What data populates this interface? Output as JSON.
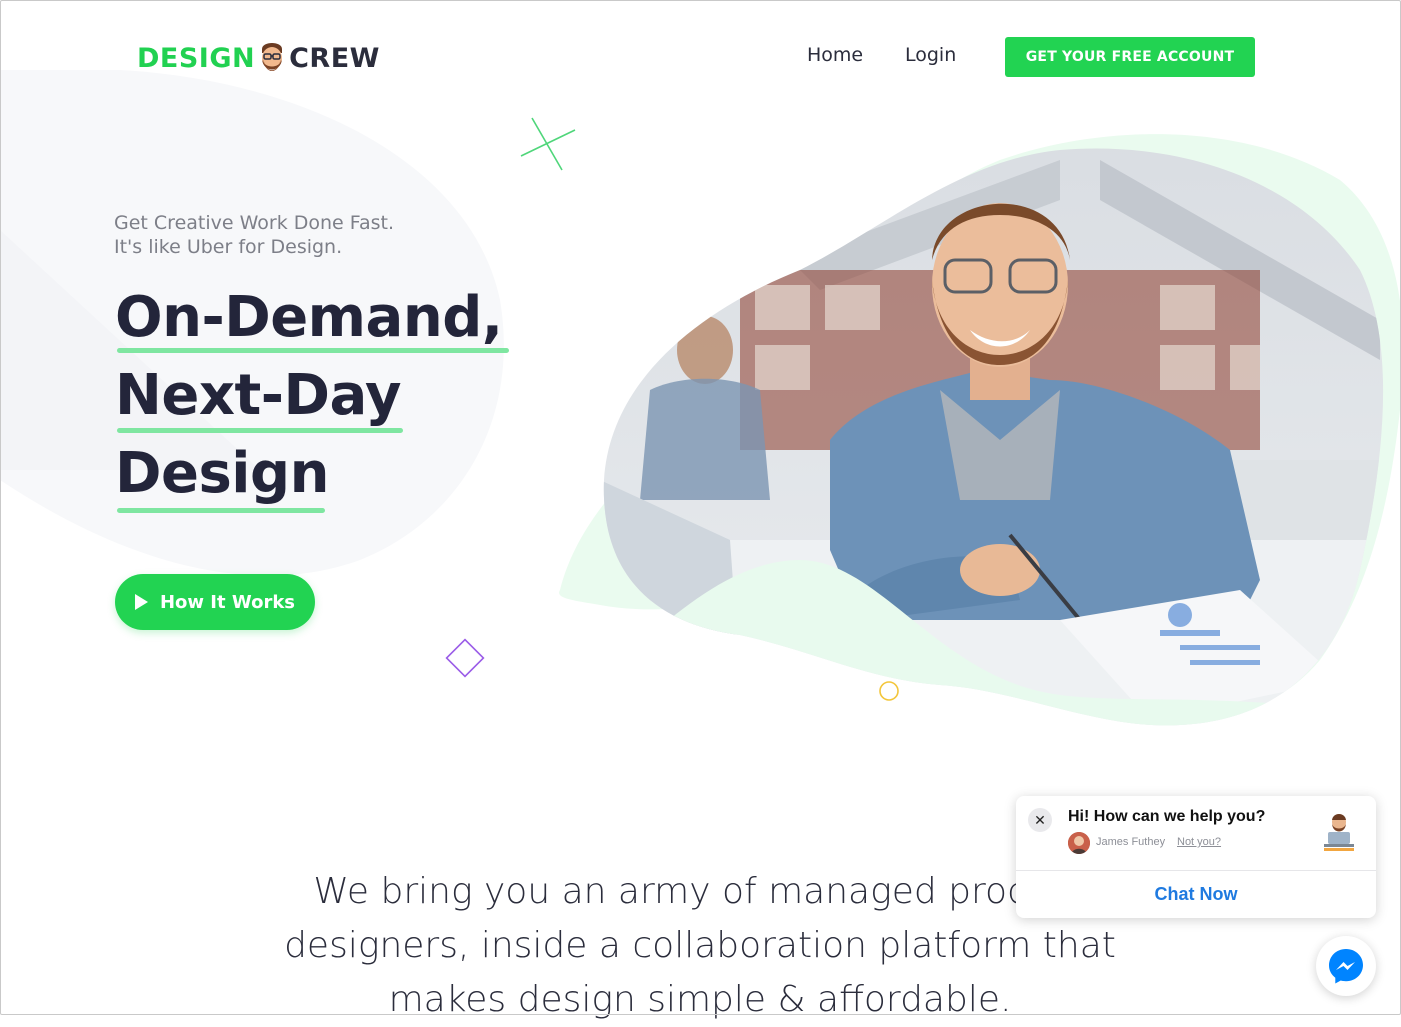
{
  "brand": {
    "part1": "DESIGN",
    "part2": "CREW",
    "accent_color": "#21d151",
    "dark_color": "#2b2d3c"
  },
  "nav": {
    "links": [
      {
        "label": "Home"
      },
      {
        "label": "Login"
      }
    ],
    "cta_label": "GET YOUR FREE ACCOUNT"
  },
  "hero": {
    "tagline_line1": "Get Creative Work Done Fast.",
    "tagline_line2": "It's like Uber for Design.",
    "headline_lines": [
      "On-Demand,",
      "Next-Day",
      "Design"
    ],
    "button_label": "How It Works",
    "button_icon": "play-icon",
    "underline_color": "#7fe6a1"
  },
  "intro": {
    "text": "We bring you an army of managed product designers, inside a collaboration platform that makes design simple & affordable."
  },
  "chat_widget": {
    "question": "Hi! How can we help you?",
    "agent_name": "James Futhey",
    "not_you": "Not you?",
    "close_icon": "close-icon",
    "action_label": "Chat Now",
    "action_color": "#1f7ae0"
  },
  "messenger": {
    "icon": "messenger-icon",
    "color": "#0084ff"
  }
}
